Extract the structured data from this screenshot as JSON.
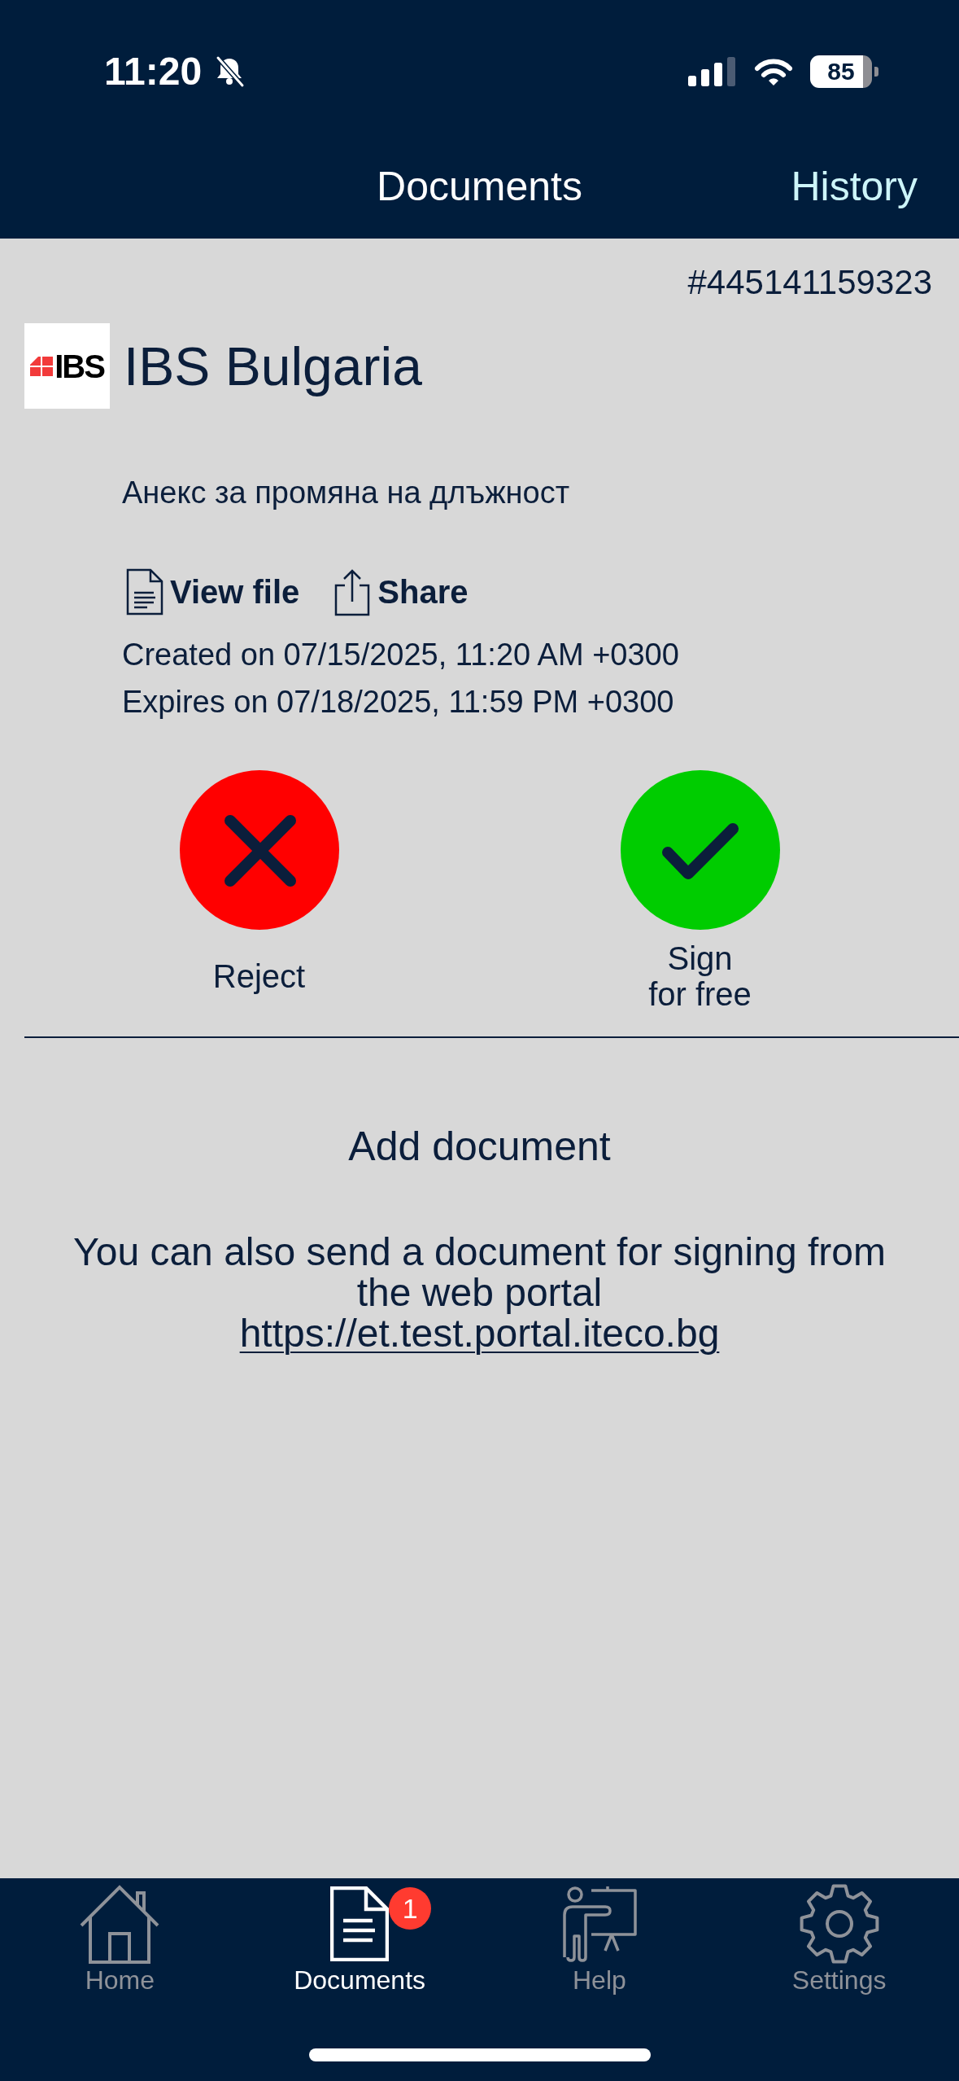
{
  "status_bar": {
    "time": "11:20",
    "silent": true,
    "battery": "85"
  },
  "header": {
    "title": "Documents",
    "action": "History"
  },
  "document": {
    "number": "#445141159323",
    "company": "IBS Bulgaria",
    "logo_text": "IBS",
    "title": "Анекс за промяна на длъжност",
    "links": [
      {
        "kind": "file",
        "label": "View file"
      },
      {
        "kind": "share",
        "label": "Share"
      }
    ],
    "created": "Created on 07/15/2025, 11:20 AM +0300",
    "expires": "Expires on 07/18/2025, 11:59 PM +0300",
    "actions": [
      {
        "kind": "reject",
        "label": "Reject"
      },
      {
        "kind": "sign",
        "label": "Sign\nfor free"
      }
    ]
  },
  "add_document": {
    "title": "Add document",
    "text": "You can also send a document for signing from the web portal",
    "link": "https://et.test.portal.iteco.bg"
  },
  "tab_bar": {
    "items": [
      {
        "kind": "home",
        "label": "Home",
        "selected": false
      },
      {
        "kind": "documents",
        "label": "Documents",
        "selected": true,
        "badge": "1"
      },
      {
        "kind": "help",
        "label": "Help",
        "selected": false
      },
      {
        "kind": "settings",
        "label": "Settings",
        "selected": false
      }
    ]
  }
}
